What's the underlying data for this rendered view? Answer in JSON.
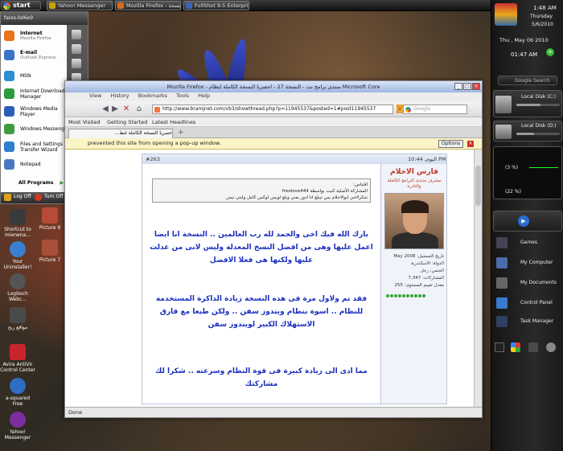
{
  "taskbar": {
    "start_label": "start",
    "tasks": [
      {
        "label": "Yahoo! Messenger",
        "color": "#c9a200"
      },
      {
        "label": "Mozilla Firefox - نسخة",
        "color": "#d86a1c"
      },
      {
        "label": "FullShot 9.5 Enterprise",
        "color": "#3b62b5"
      }
    ]
  },
  "start_menu": {
    "user": "fares-bd6e9",
    "items": [
      {
        "title": "Internet",
        "sub": "Mozilla Firefox",
        "bold": true,
        "color": "#e8731a"
      },
      {
        "title": "E-mail",
        "sub": "Outlook Express",
        "bold": true,
        "color": "#3a73c9"
      },
      {
        "title": "MSN",
        "sub": "",
        "bold": false,
        "color": "#2c8fd6"
      },
      {
        "title": "Internet Download Manager",
        "sub": "",
        "bold": false,
        "color": "#2b9b3c"
      },
      {
        "title": "Windows Media Player",
        "sub": "",
        "bold": false,
        "color": "#2a5fb5"
      },
      {
        "title": "Windows Messenger",
        "sub": "",
        "bold": false,
        "color": "#3f9b3f"
      },
      {
        "title": "Files and Settings Transfer Wizard",
        "sub": "",
        "bold": false,
        "color": "#2f7fcf"
      },
      {
        "title": "Notepad",
        "sub": "",
        "bold": false,
        "color": "#4a78c0"
      }
    ],
    "all_programs": "All Programs",
    "log_off": "Log Off",
    "turn_off": "Turn Off Computer"
  },
  "desktop_icons": [
    {
      "label": "Shortcut to mienena...",
      "color": "#3a3a3a"
    },
    {
      "label": "Picture 9",
      "color": "#b84a3a"
    },
    {
      "label": "Your Uninstaller!",
      "color": "#3b7fd0"
    },
    {
      "label": "Picture 7",
      "color": "#a8503a"
    },
    {
      "label": "Logitech Webc...",
      "color": "#555"
    },
    {
      "label": "مواقع ربح",
      "color": "#4a4a4a"
    },
    {
      "label": "Avira AntiVir Control Center",
      "color": "#c8252b"
    },
    {
      "label": "a-squared Free",
      "color": "#2d6ec2"
    },
    {
      "label": "Yahoo! Messenger",
      "color": "#7c2ea0"
    }
  ],
  "browser": {
    "title": "Mozilla Firefox - منتدى برامج نت - النسخة 27 - احصريا النسخة الكاملة لنظام Microsoft Core",
    "menu": [
      "View",
      "History",
      "Bookmarks",
      "Tools",
      "Help"
    ],
    "url": "http://www.bramjnet.com/vb3/showthread.php?p=11945537&posted=1#post11945537",
    "search_placeholder": "Google",
    "bookmarks": [
      "Most Visited",
      "Getting Started",
      "Latest Headlines"
    ],
    "tab_label": "حصريا النسخة الكاملة لنظ...",
    "infobar": "prevented this site from opening a pop-up window.",
    "infobar_options": "Options",
    "status": "Done"
  },
  "post": {
    "number": "#263",
    "date": "اليوم, 10:44 PM",
    "quote_title": "اقتباس:",
    "quote_author": "المشاركة الأصلية كتبت بواسطة freelove444",
    "quote_text": "شكرااخي ابوالاحلام بس تيبلغ انا ادور يعني وبلغ لوبس لوكس كامل ولبتي تيس",
    "paragraphs": [
      "بارك الله فيك اخى والحمد لله رب العالمين .. النسخة انا ايضا اعمل عليها وهى من افضل النسخ المعدلة وليس لانى من عدلت عليها ولكنها هى فعلا الافضل",
      "فقد تم ولاول مرة فى هذه النسخة زيادة الذاكرة المستخدمة للنظام .. اسوة بنظام ويندوز سفن .. ولكن طبعا مع فارق الاستهلاك الكبير لويندوز سفن",
      "مما ادى الى زيادة كبيرة فى قوة النظام وسرعته .. شكرا لك مشاركتك"
    ],
    "username": "فارس الاحلام",
    "user_title": "مشرف منتدى البرامج الكاملة والنادرة",
    "join_date": "تاريخ التسجيل: May 2008",
    "country": "الدولة: الاسكندرية",
    "gender": "الجنس: رجل",
    "posts": "المشاركات: 7,347",
    "rep": "معدل تقييم المستوى: 255"
  },
  "gadgets": {
    "time": "1:48 AM",
    "day": "Thursday",
    "date": "5/6/2010",
    "clock_date": "Thu , May 06 2010",
    "clock_time": "01:47 AM",
    "search": "Google Search",
    "disk_c": "Local Disk (C:)",
    "disk_d": "Local Disk (D:)",
    "cpu": "(3 %)",
    "ram": "(22 %)",
    "links": [
      "Games",
      "My Computer",
      "My Documents",
      "Control Panel",
      "Task Manager"
    ]
  }
}
